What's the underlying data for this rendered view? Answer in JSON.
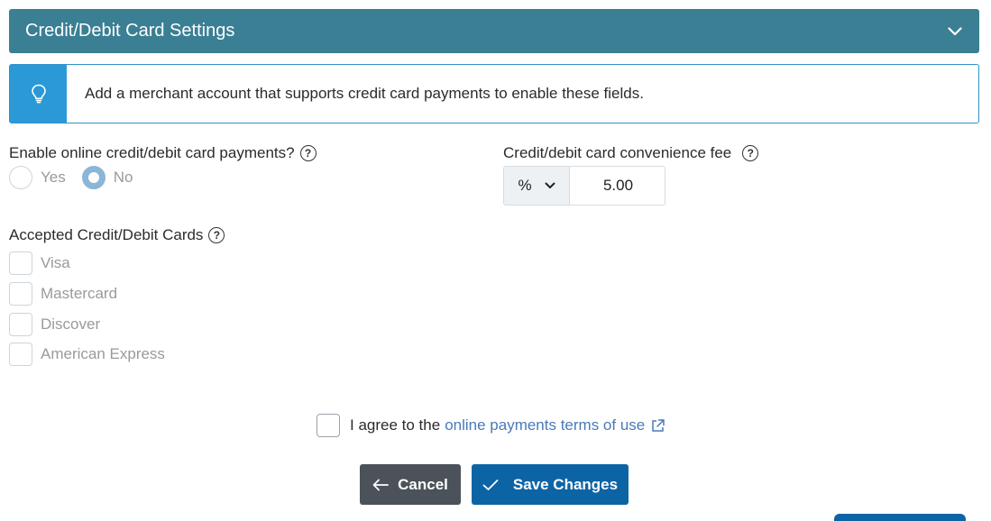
{
  "header": {
    "title": "Credit/Debit Card Settings",
    "toggle_icon": "chevron-down-icon"
  },
  "info": {
    "icon": "lightbulb-icon",
    "text": "Add a merchant account that supports credit card payments to enable these fields."
  },
  "online_payments": {
    "label": "Enable online credit/debit card payments?",
    "options": [
      "Yes",
      "No"
    ],
    "selected": "No"
  },
  "convenience_fee": {
    "label": "Credit/debit card convenience fee",
    "type_selected": "%",
    "value": "5.00"
  },
  "accepted_cards": {
    "label": "Accepted Credit/Debit Cards",
    "cards": [
      "Visa",
      "Mastercard",
      "Discover",
      "American Express"
    ]
  },
  "terms": {
    "text": "I agree to the",
    "link_text": "online payments terms of use"
  },
  "buttons": {
    "cancel": "Cancel",
    "save": "Save Changes"
  },
  "colors": {
    "header": "#3a7f94",
    "info_accent": "#2b99d6",
    "save": "#0d64a5",
    "cancel": "#4b5259",
    "link": "#4a79b8"
  }
}
